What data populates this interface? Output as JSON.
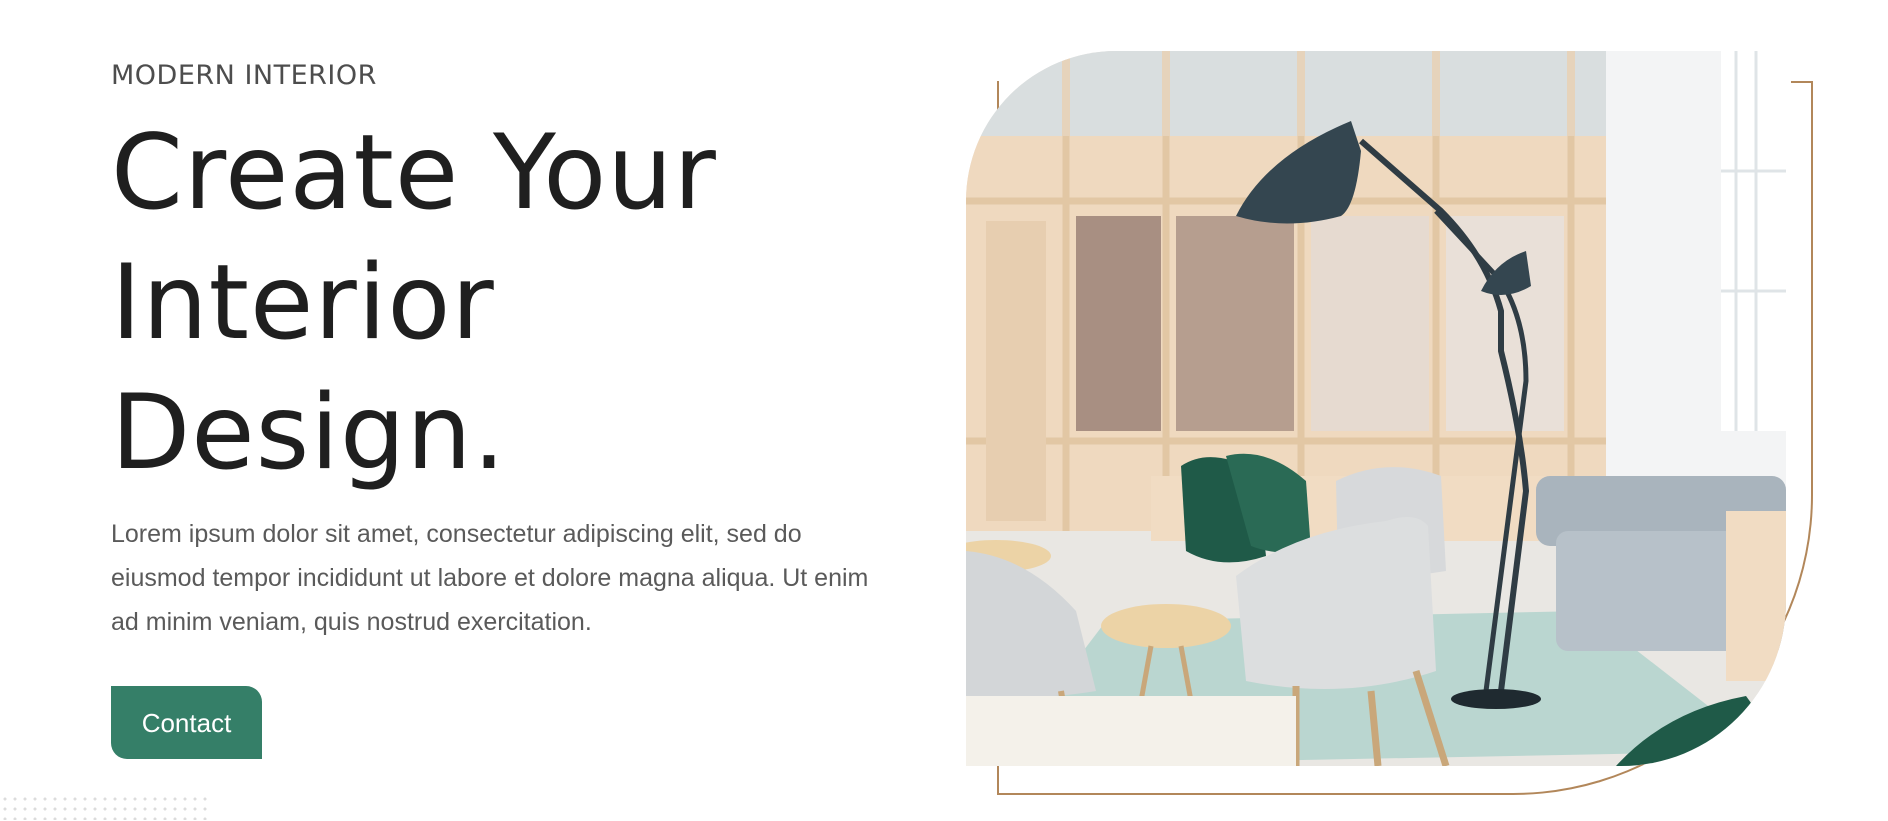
{
  "hero": {
    "eyebrow": "MODERN INTERIOR",
    "headline": [
      "Create Your",
      "Interior",
      "Design."
    ],
    "description": "Lorem ipsum dolor sit amet, consectetur adipiscing elit, sed do eiusmod tempor incididunt ut labore et dolore magna aliqua. Ut enim ad minim veniam, quis nostrud exercitation.",
    "cta_label": "Contact"
  },
  "colors": {
    "accent": "#357f68",
    "frame": "#b2875a",
    "heading": "#1f1f1f",
    "body_text": "#5a5a5a"
  },
  "image": {
    "alt": "Modern interior with chairs, sofa and floor lamp"
  }
}
